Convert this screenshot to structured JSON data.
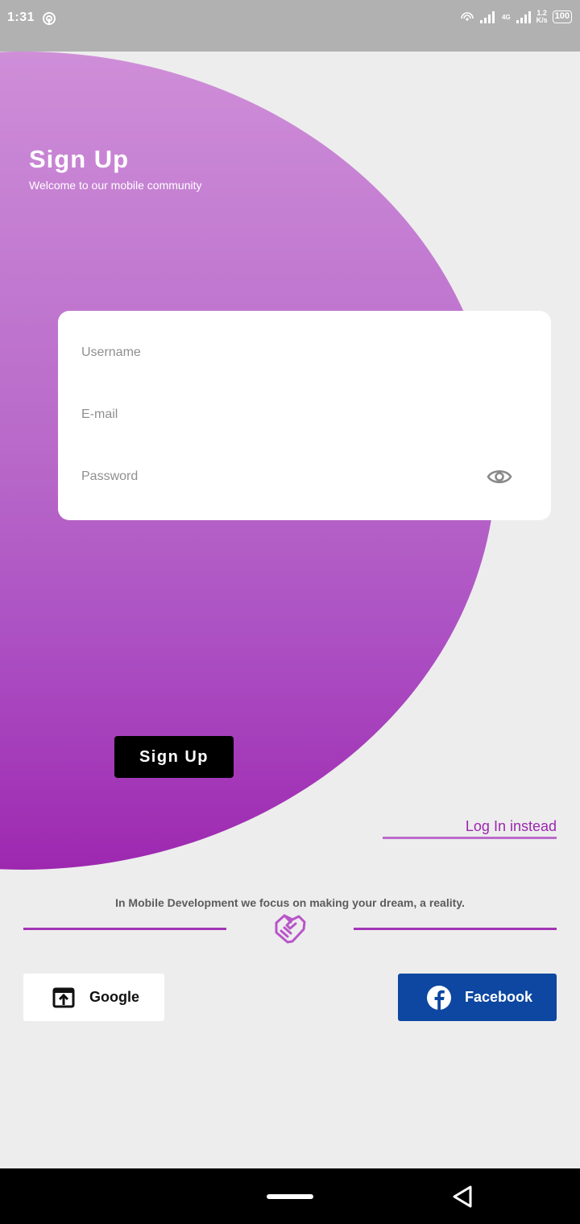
{
  "status_bar": {
    "time": "1:31",
    "network": "4G",
    "speed_value": "1.2",
    "speed_unit": "K/s",
    "battery": "100"
  },
  "header": {
    "title": "Sign Up",
    "subtitle": "Welcome to our mobile community"
  },
  "form": {
    "username_placeholder": "Username",
    "email_placeholder": "E-mail",
    "password_placeholder": "Password"
  },
  "actions": {
    "signup_label": "Sign Up",
    "login_label": "Log In instead"
  },
  "tagline": "In Mobile Development we focus on making your dream, a reality.",
  "social": {
    "google_label": "Google",
    "facebook_label": "Facebook"
  },
  "colors": {
    "accent": "#9c27b0",
    "facebook_blue": "#0d47a1",
    "background": "#ededed"
  },
  "icons": [
    "hotspot-icon",
    "signal-icon",
    "eye-icon",
    "handshake-icon",
    "open-in-browser-icon",
    "facebook-icon",
    "back-icon"
  ]
}
